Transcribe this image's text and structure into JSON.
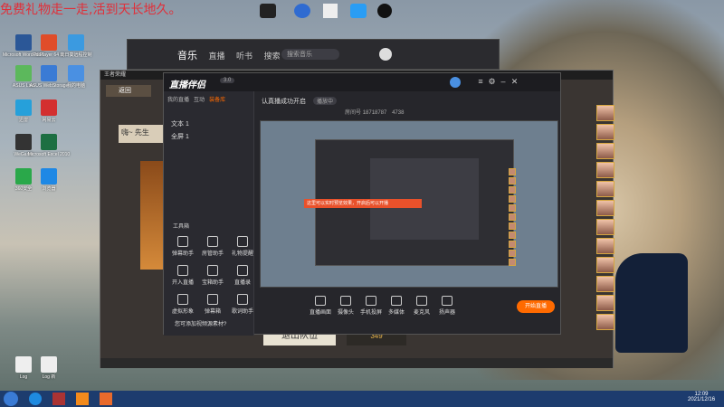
{
  "banner": "免费礼物走一走,活到天长地久。",
  "desktop_icons": [
    {
      "label": "Microsoft Word 2010"
    },
    {
      "label": "PotPlayer 64 bit"
    },
    {
      "label": "向日葵远程控制"
    },
    {
      "label": "ASUS Live"
    },
    {
      "label": "ASUS WebStorage"
    },
    {
      "label": "我的电脑"
    },
    {
      "label": "迅雷"
    },
    {
      "label": "网易云"
    },
    {
      "label": "WeGame"
    },
    {
      "label": "Microsoft Excel 2010"
    },
    {
      "label": "360安全"
    },
    {
      "label": "浏览器"
    },
    {
      "label": "Log"
    },
    {
      "label": "Log 新"
    }
  ],
  "music_window": {
    "tabs": [
      "音乐",
      "直播",
      "听书",
      "搜索"
    ],
    "search_placeholder": "搜索音乐"
  },
  "game_window": {
    "title": "王者荣耀",
    "back": "返回",
    "text_left": "嗨~ 先生",
    "exit_button": "退出队伍",
    "price": "349"
  },
  "stream_window": {
    "logo": "直播伴侣",
    "badge": "3.0",
    "nav": [
      "我的直播",
      "互动",
      "装备库"
    ],
    "layers": [
      "文本 1",
      "全屏 1"
    ],
    "tools_header": "工具箱",
    "tools": [
      {
        "label": "弹幕助手"
      },
      {
        "label": "房管助手"
      },
      {
        "label": "礼物提醒"
      },
      {
        "label": "开入直播"
      },
      {
        "label": "宝箱助手"
      },
      {
        "label": "直播录"
      },
      {
        "label": "虚拟形象"
      },
      {
        "label": "弹幕箱"
      },
      {
        "label": "歌词助手"
      }
    ],
    "tip": "您可添加视频源素材?",
    "status_title": "认真播成功开启",
    "status_tag": "播放中",
    "room_label": "房间号",
    "room_number": "18718787",
    "viewers": "4738",
    "overlay_banner": "这里可以实时预览效果，开启后可以开播",
    "bottom": [
      "直播画面",
      "摄像头",
      "手机投屏",
      "多媒体",
      "麦克风",
      "扬声器"
    ],
    "start_button": "开始直播"
  },
  "taskbar": {
    "time": "12:09",
    "date": "2021/12/16"
  },
  "colors": {
    "accent": "#ff6a00",
    "banner": "#e0303a"
  }
}
